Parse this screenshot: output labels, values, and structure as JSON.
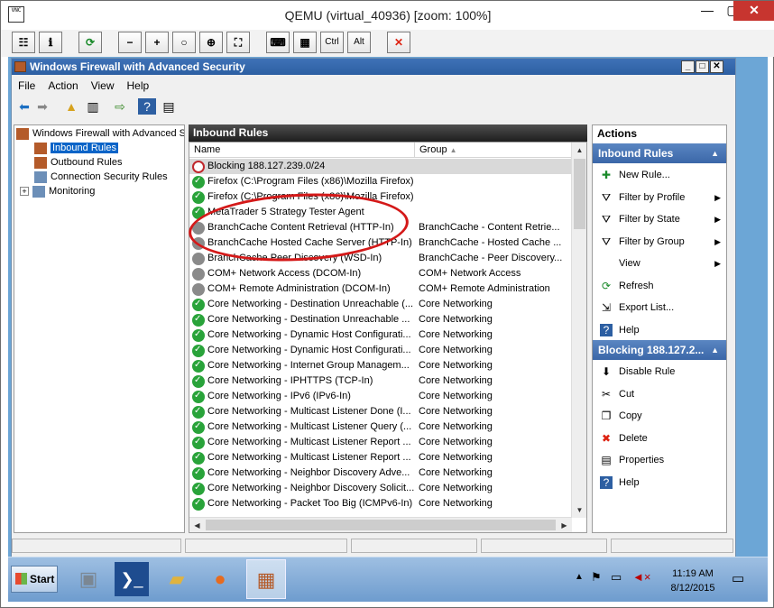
{
  "qemu": {
    "title": "QEMU (virtual_40936) [zoom: 100%]",
    "logo_text": "VNC",
    "toolbar": [
      {
        "icon": "clipboard-icon",
        "glyph": "☷"
      },
      {
        "icon": "info-icon",
        "glyph": "ℹ"
      },
      {
        "icon": "refresh-icon",
        "glyph": "⟳"
      },
      {
        "icon": "zoom-out-icon",
        "glyph": "−"
      },
      {
        "icon": "zoom-in-icon",
        "glyph": "+"
      },
      {
        "icon": "zoom-reset-icon",
        "glyph": "○"
      },
      {
        "icon": "zoom-auto-icon",
        "glyph": "⊕"
      },
      {
        "icon": "fullscreen-icon",
        "glyph": "⛶"
      },
      {
        "icon": "send-keys-icon",
        "glyph": "⌨"
      },
      {
        "icon": "ctrl-alt-del-icon",
        "glyph": "▦"
      },
      {
        "icon": "ctrl-key-icon",
        "glyph": "Ctrl"
      },
      {
        "icon": "alt-key-icon",
        "glyph": "Alt"
      },
      {
        "icon": "disconnect-icon",
        "glyph": "✕"
      }
    ]
  },
  "mmc": {
    "title": "Windows Firewall with Advanced Security",
    "menu": [
      "File",
      "Action",
      "View",
      "Help"
    ],
    "tree": {
      "root": "Windows Firewall with Advanced S",
      "items": [
        "Inbound Rules",
        "Outbound Rules",
        "Connection Security Rules",
        "Monitoring"
      ]
    },
    "center_header": "Inbound Rules",
    "columns": {
      "name": "Name",
      "group": "Group"
    },
    "rows": [
      {
        "status": "blk",
        "name": "Blocking 188.127.239.0/24",
        "group": ""
      },
      {
        "status": "ok",
        "name": "Firefox (C:\\Program Files (x86)\\Mozilla Firefox)",
        "group": ""
      },
      {
        "status": "ok",
        "name": "Firefox (C:\\Program Files (x86)\\Mozilla Firefox)",
        "group": ""
      },
      {
        "status": "ok",
        "name": "MetaTrader 5 Strategy Tester Agent",
        "group": ""
      },
      {
        "status": "off",
        "name": "BranchCache Content Retrieval (HTTP-In)",
        "group": "BranchCache - Content Retrie..."
      },
      {
        "status": "off",
        "name": "BranchCache Hosted Cache Server (HTTP-In)",
        "group": "BranchCache - Hosted Cache ..."
      },
      {
        "status": "off",
        "name": "BranchCache Peer Discovery (WSD-In)",
        "group": "BranchCache - Peer Discovery..."
      },
      {
        "status": "off",
        "name": "COM+ Network Access (DCOM-In)",
        "group": "COM+ Network Access"
      },
      {
        "status": "off",
        "name": "COM+ Remote Administration (DCOM-In)",
        "group": "COM+ Remote Administration"
      },
      {
        "status": "ok",
        "name": "Core Networking - Destination Unreachable (...",
        "group": "Core Networking"
      },
      {
        "status": "ok",
        "name": "Core Networking - Destination Unreachable ...",
        "group": "Core Networking"
      },
      {
        "status": "ok",
        "name": "Core Networking - Dynamic Host Configurati...",
        "group": "Core Networking"
      },
      {
        "status": "ok",
        "name": "Core Networking - Dynamic Host Configurati...",
        "group": "Core Networking"
      },
      {
        "status": "ok",
        "name": "Core Networking - Internet Group Managem...",
        "group": "Core Networking"
      },
      {
        "status": "ok",
        "name": "Core Networking - IPHTTPS (TCP-In)",
        "group": "Core Networking"
      },
      {
        "status": "ok",
        "name": "Core Networking - IPv6 (IPv6-In)",
        "group": "Core Networking"
      },
      {
        "status": "ok",
        "name": "Core Networking - Multicast Listener Done (I...",
        "group": "Core Networking"
      },
      {
        "status": "ok",
        "name": "Core Networking - Multicast Listener Query (...",
        "group": "Core Networking"
      },
      {
        "status": "ok",
        "name": "Core Networking - Multicast Listener Report ...",
        "group": "Core Networking"
      },
      {
        "status": "ok",
        "name": "Core Networking - Multicast Listener Report ...",
        "group": "Core Networking"
      },
      {
        "status": "ok",
        "name": "Core Networking - Neighbor Discovery Adve...",
        "group": "Core Networking"
      },
      {
        "status": "ok",
        "name": "Core Networking - Neighbor Discovery Solicit...",
        "group": "Core Networking"
      },
      {
        "status": "ok",
        "name": "Core Networking - Packet Too Big (ICMPv6-In)",
        "group": "Core Networking"
      }
    ],
    "actions": {
      "header": "Actions",
      "section1": "Inbound Rules",
      "section1_items": [
        {
          "label": "New Rule...",
          "icon": "new-rule-icon",
          "glyph": "✚",
          "sub": false
        },
        {
          "label": "Filter by Profile",
          "icon": "filter-icon",
          "glyph": "⛛",
          "sub": true
        },
        {
          "label": "Filter by State",
          "icon": "filter-icon",
          "glyph": "⛛",
          "sub": true
        },
        {
          "label": "Filter by Group",
          "icon": "filter-icon",
          "glyph": "⛛",
          "sub": true
        },
        {
          "label": "View",
          "icon": "",
          "glyph": "",
          "sub": true
        },
        {
          "label": "Refresh",
          "icon": "refresh-icon",
          "glyph": "⟳",
          "sub": false
        },
        {
          "label": "Export List...",
          "icon": "export-icon",
          "glyph": "⇲",
          "sub": false
        },
        {
          "label": "Help",
          "icon": "help-icon",
          "glyph": "?",
          "sub": false
        }
      ],
      "section2": "Blocking 188.127.2...",
      "section2_items": [
        {
          "label": "Disable Rule",
          "icon": "disable-icon",
          "glyph": "⬇"
        },
        {
          "label": "Cut",
          "icon": "cut-icon",
          "glyph": "✂"
        },
        {
          "label": "Copy",
          "icon": "copy-icon",
          "glyph": "❐"
        },
        {
          "label": "Delete",
          "icon": "delete-icon",
          "glyph": "✖"
        },
        {
          "label": "Properties",
          "icon": "properties-icon",
          "glyph": "▤"
        },
        {
          "label": "Help",
          "icon": "help-icon",
          "glyph": "?"
        }
      ]
    }
  },
  "taskbar": {
    "start": "Start",
    "time": "11:19 AM",
    "date": "8/12/2015"
  },
  "colors": {
    "accent": "#2d5fa2",
    "highlight": "#c0282d"
  }
}
